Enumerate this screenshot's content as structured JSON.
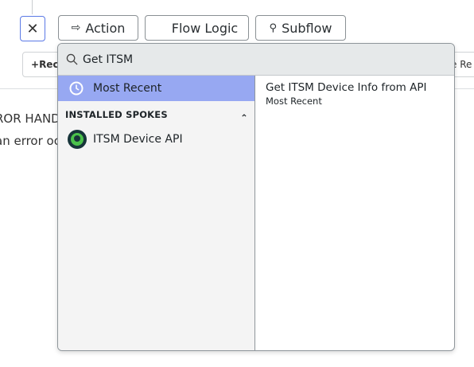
{
  "toolbar": {
    "close_icon": "close-icon",
    "action": "Action",
    "flow_logic": "Flow Logic",
    "subflow": "Subflow"
  },
  "background": {
    "left_button": "Rec",
    "right_button": "e Re",
    "heading": "ROR HAND",
    "text": "an error oc"
  },
  "dropdown": {
    "search_value": "Get ITSM",
    "most_recent": "Most Recent",
    "section_title": "INSTALLED SPOKES",
    "spokes": [
      {
        "label": "ITSM Device API"
      }
    ],
    "results": [
      {
        "title": "Get ITSM Device Info from API",
        "subtitle": "Most Recent"
      }
    ]
  },
  "colors": {
    "selected": "#97a8f2",
    "spoke_icon": "#4bc24b"
  }
}
